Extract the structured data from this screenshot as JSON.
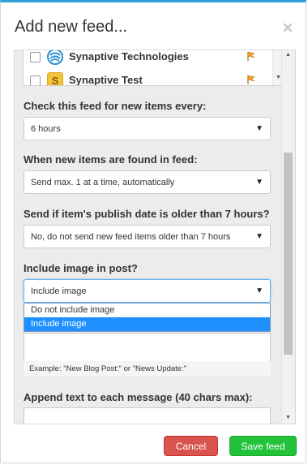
{
  "modal": {
    "title": "Add new feed...",
    "close_icon": "close-icon"
  },
  "profiles": [
    {
      "name": "Synaptive Technologies",
      "icon": "synaptive-logo-icon",
      "checked": false,
      "flag_icon": "flag-icon"
    },
    {
      "name": "Synaptive Test",
      "icon": "s-badge-icon",
      "checked": false,
      "flag_icon": "flag-icon"
    }
  ],
  "check_frequency": {
    "label": "Check this feed for new items every:",
    "value": "6 hours"
  },
  "new_items": {
    "label": "When new items are found in feed:",
    "value": "Send max. 1 at a time, automatically"
  },
  "publish_date": {
    "label": "Send if item's publish date is older than 7 hours?",
    "value": "No, do not send new feed items older than 7 hours"
  },
  "include_image": {
    "label": "Include image in post?",
    "value": "Include image",
    "options": [
      {
        "label": "Do not include image",
        "selected": false
      },
      {
        "label": "Include image",
        "selected": true
      }
    ]
  },
  "prepend": {
    "example": "Example: \"New Blog Post:\" or \"News Update:\""
  },
  "append": {
    "label": "Append text to each message (40 chars max):"
  },
  "buttons": {
    "cancel": "Cancel",
    "save": "Save feed"
  },
  "colors": {
    "accent_top_border": "#2e9fd8",
    "cancel": "#d9534f",
    "save": "#22c33a",
    "selected_option": "#1e90ff"
  }
}
